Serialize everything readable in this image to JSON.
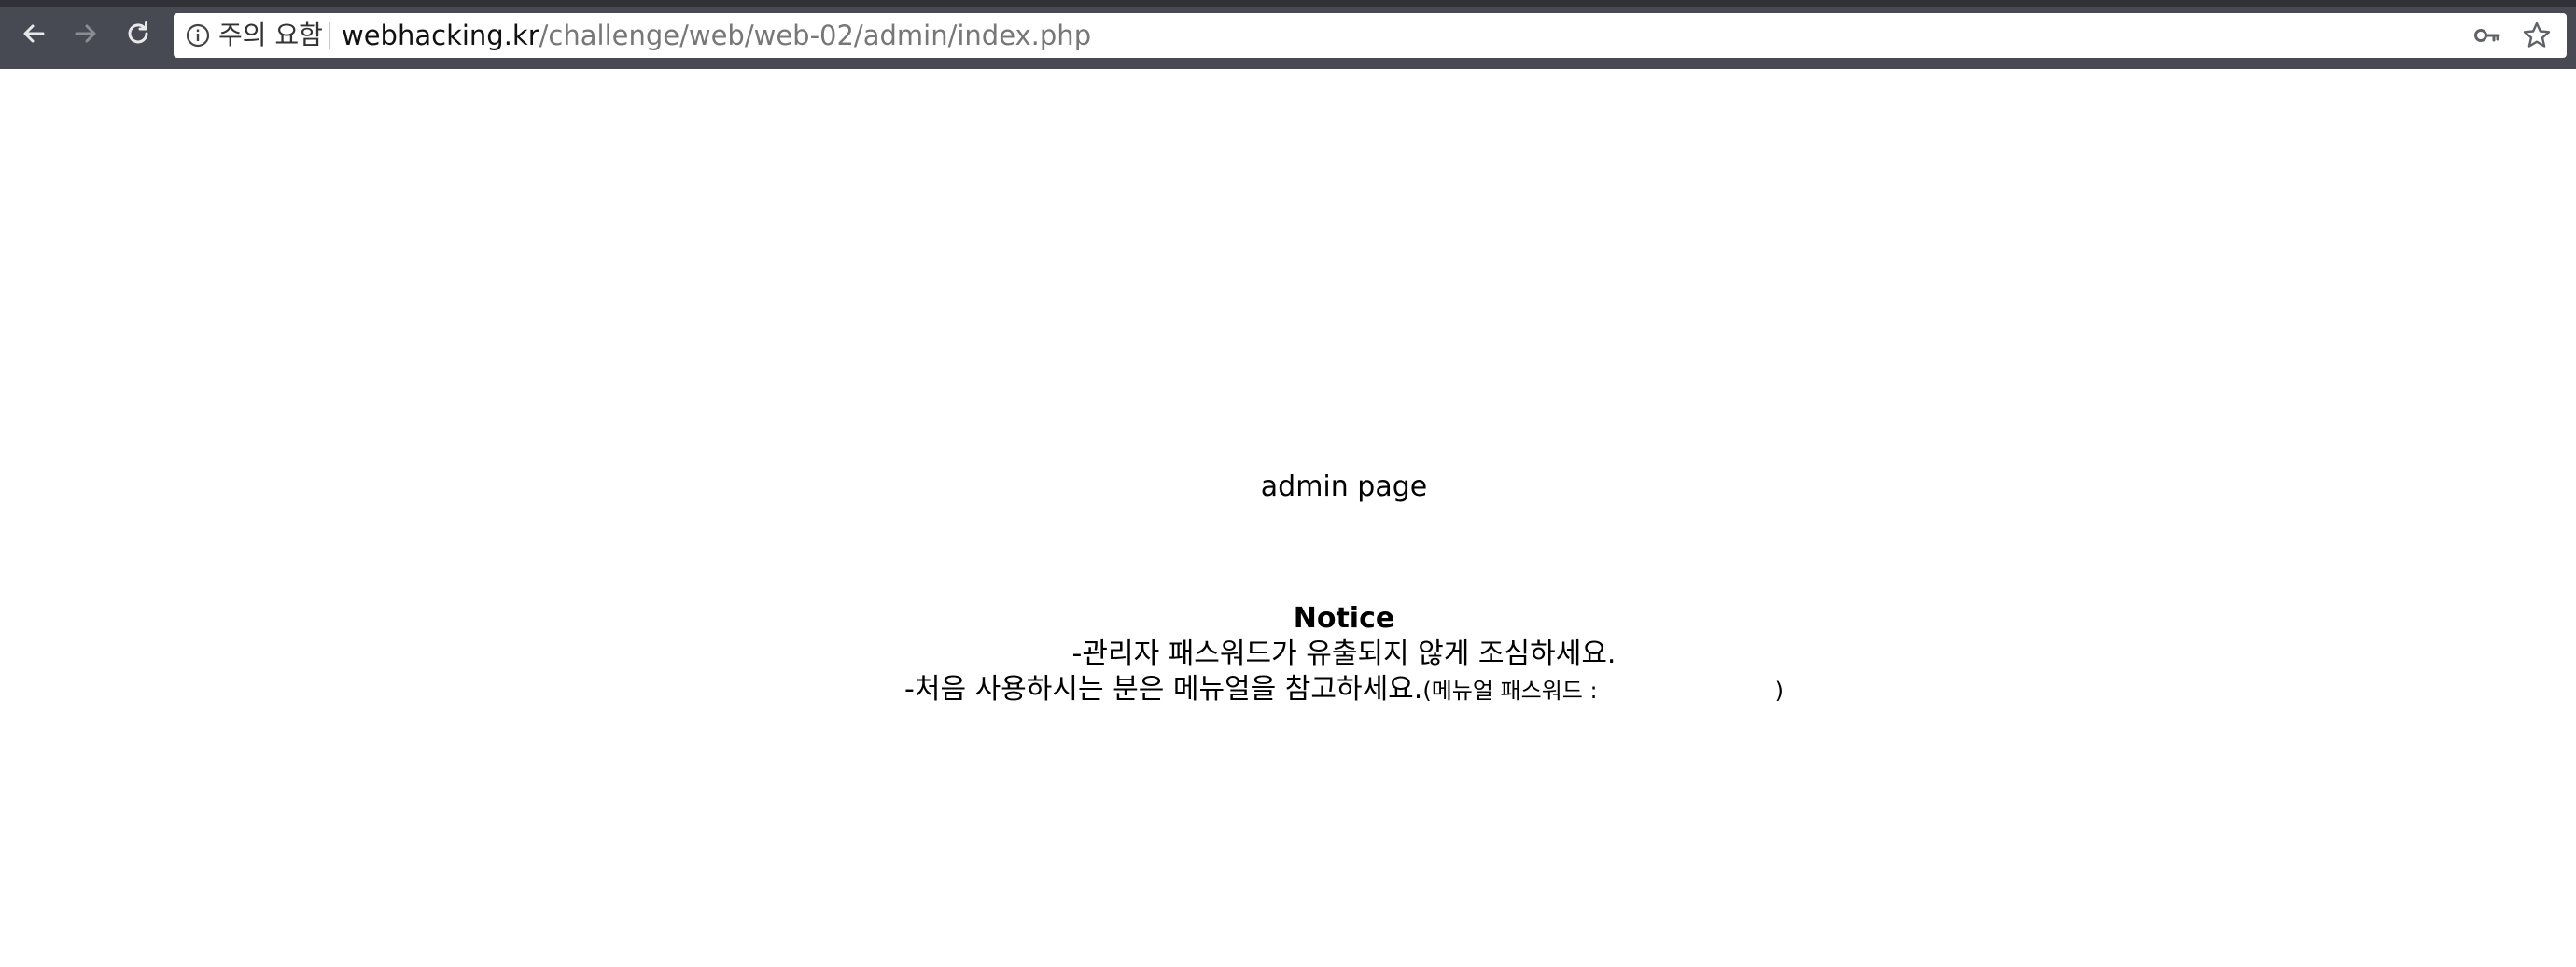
{
  "browser": {
    "security_label": "주의 요함",
    "url_host": "webhacking.kr",
    "url_path": "/challenge/web/web-02/admin/index.php",
    "icons": {
      "back": "arrow-left-icon",
      "forward": "arrow-right-icon",
      "reload": "reload-icon",
      "info": "info-icon",
      "key": "key-icon",
      "star": "star-icon"
    }
  },
  "page": {
    "title": "admin page",
    "notice": {
      "heading": "Notice",
      "line1": "-관리자 패스워드가 유출되지 않게 조심하세요.",
      "line2": "-처음 사용하시는 분은 메뉴얼을 참고하세요.",
      "manual_open": "(메뉴얼 패스워드 :",
      "manual_close": ")"
    }
  }
}
